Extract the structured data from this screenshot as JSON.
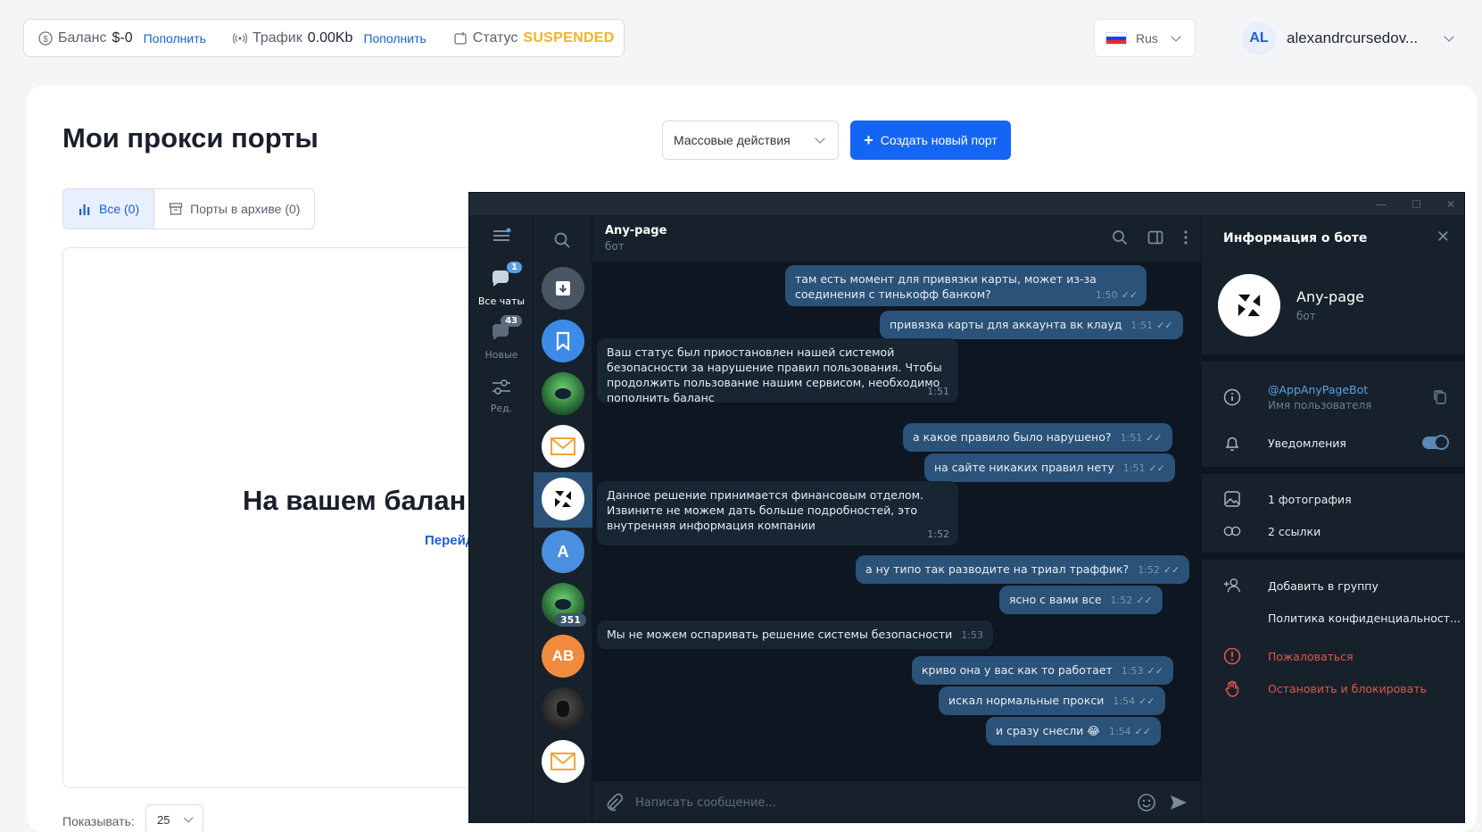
{
  "topbar": {
    "balance_label": "Баланс",
    "balance_value": "$-0",
    "balance_link": "Пополнить",
    "traffic_label": "Трафик",
    "traffic_value": "0.00Kb",
    "traffic_link": "Пополнить",
    "status_label": "Статус",
    "status_value": "SUSPENDED",
    "status_color": "#f0b429"
  },
  "language": {
    "selected": "Rus"
  },
  "account": {
    "initials": "AL",
    "name": "alexandrcursedov..."
  },
  "page": {
    "title": "Мои прокси порты",
    "bulk_actions": "Массовые действия",
    "create_button": "Создать новый порт",
    "tabs": [
      {
        "label": "Все (0)",
        "icon": "bar-chart-icon",
        "active": true
      },
      {
        "label": "Порты в архиве (0)",
        "icon": "archive-icon",
        "active": false
      }
    ],
    "empty_title": "На вашем балан",
    "empty_link": "Перейд",
    "show_label": "Показывать:",
    "per_page": "25"
  },
  "telegram": {
    "rail": [
      {
        "label": "Все чаты",
        "badge": "1",
        "icon": "chats-icon"
      },
      {
        "label": "Новые",
        "badge": "43",
        "icon": "new-chats-icon"
      },
      {
        "label": "Ред.",
        "badge": "",
        "icon": "edit-folders-icon"
      }
    ],
    "chat_list": [
      {
        "kind": "archive",
        "icon": "archive-icon",
        "color": "#4a5563"
      },
      {
        "kind": "saved",
        "icon": "bookmark-icon",
        "color": "#3d8be8"
      },
      {
        "kind": "image",
        "icon": "green-avatar",
        "color": "#1e5a2e"
      },
      {
        "kind": "mail",
        "icon": "mail-icon",
        "color": "#ffffff"
      },
      {
        "kind": "selected",
        "icon": "anypage-logo-icon",
        "color": "#ffffff"
      },
      {
        "kind": "letter",
        "letter": "A",
        "color": "#4b8fe0"
      },
      {
        "kind": "image",
        "icon": "green-avatar",
        "color": "#1e5a2e",
        "badge": "351"
      },
      {
        "kind": "letter",
        "letter": "AB",
        "color": "#f08a3c"
      },
      {
        "kind": "image",
        "icon": "photo-avatar",
        "color": "#3a3a3a"
      },
      {
        "kind": "mail",
        "icon": "mail-icon",
        "color": "#ffffff"
      }
    ],
    "chat": {
      "title": "Any-page",
      "subtitle": "бот",
      "composer_placeholder": "Написать сообщение...",
      "messages": [
        {
          "dir": "out",
          "text": "там есть момент для привязки карты, может из-за соединения с тинькофф банком?",
          "time": "1:50"
        },
        {
          "dir": "out",
          "text": "привязка карты для аккаунта вк клауд",
          "time": "1:51"
        },
        {
          "dir": "in",
          "text": "Ваш статус был приостановлен нашей системой безопасности за нарушение правил пользования. Чтобы продолжить пользование нашим сервисом, необходимо пополнить баланс",
          "time": "1:51"
        },
        {
          "dir": "out",
          "text": "а какое правило было нарушено?",
          "time": "1:51"
        },
        {
          "dir": "out",
          "text": "на сайте никаких правил нету",
          "time": "1:51"
        },
        {
          "dir": "in",
          "text": "Данное решение принимается финансовым отделом. Извините не можем дать больше подробностей, это внутренняя информация компании",
          "time": "1:52"
        },
        {
          "dir": "out",
          "text": "а ну типо так разводите на триал траффик?",
          "time": "1:52"
        },
        {
          "dir": "out",
          "text": "ясно с вами все",
          "time": "1:52"
        },
        {
          "dir": "in",
          "text": "Мы не можем оспаривать решение системы безопасности",
          "time": "1:53"
        },
        {
          "dir": "out",
          "text": "криво она у вас как то работает",
          "time": "1:53"
        },
        {
          "dir": "out",
          "text": "искал нормальные прокси",
          "time": "1:54"
        },
        {
          "dir": "out",
          "text": "и сразу снесли 😂",
          "time": "1:54"
        }
      ]
    },
    "info": {
      "header": "Информация о боте",
      "bot_name": "Any-page",
      "bot_sub": "бот",
      "username": "@AppAnyPageBot",
      "username_label": "Имя пользователя",
      "notifications": "Уведомления",
      "photos": "1 фотография",
      "links": "2 ссылки",
      "add_to_group": "Добавить в группу",
      "privacy": "Политика конфиденциальност...",
      "report": "Пожаловаться",
      "block": "Остановить и блокировать"
    }
  }
}
